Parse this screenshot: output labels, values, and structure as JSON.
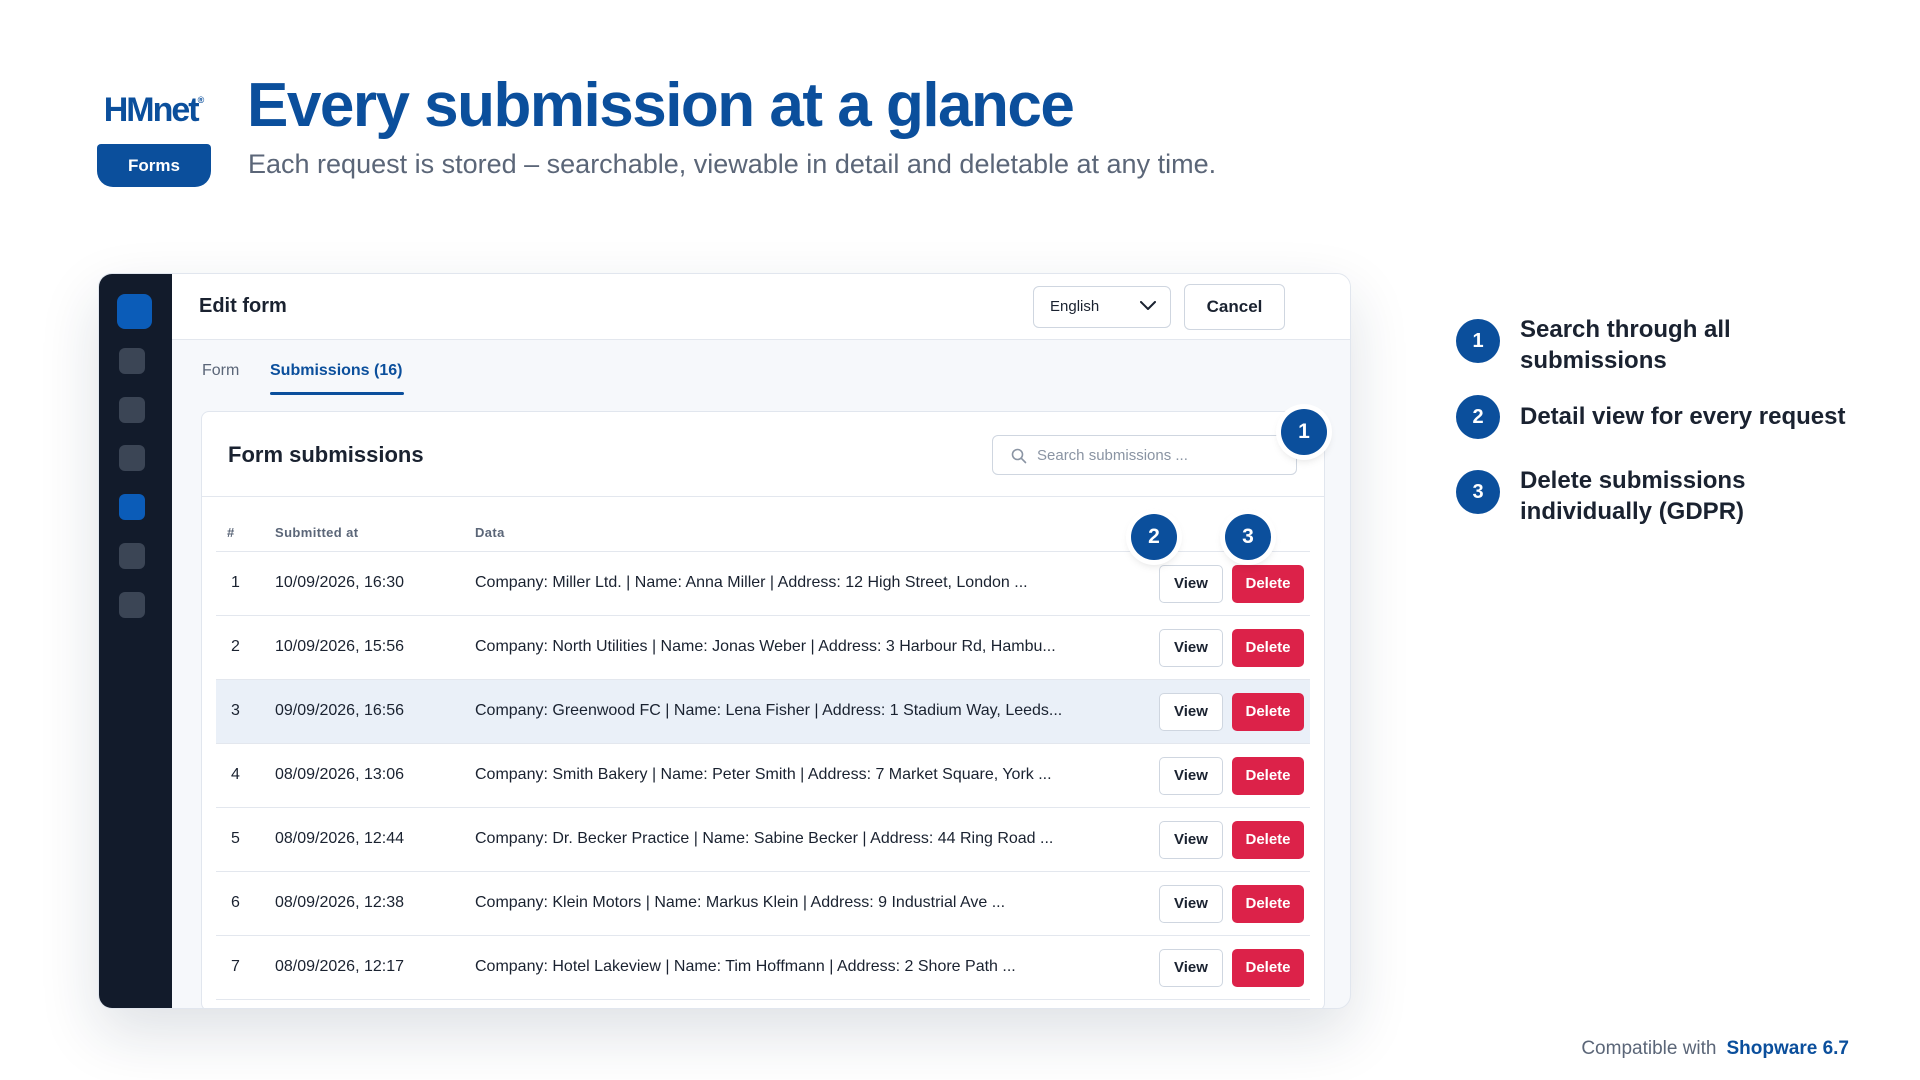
{
  "brand": {
    "logo_text": "HMnet",
    "logo_mark": "®",
    "badge": "Forms"
  },
  "hero": {
    "title": "Every submission at a glance",
    "subtitle": "Each request is stored – searchable, viewable in detail and deletable at any time."
  },
  "colors": {
    "primary": "#0b4f9c",
    "danger": "#dc2249",
    "sidebar": "#121b2b",
    "highlight_row": "#eaf0f8"
  },
  "window": {
    "title": "Edit form",
    "language": "English",
    "cancel_label": "Cancel",
    "tabs": [
      {
        "label": "Form",
        "active": false
      },
      {
        "label": "Submissions (16)",
        "active": true
      }
    ],
    "card": {
      "title": "Form submissions",
      "search_placeholder": "Search submissions ...",
      "columns": [
        "#",
        "Submitted at",
        "Data"
      ],
      "view_label": "View",
      "delete_label": "Delete",
      "rows": [
        {
          "num": "1",
          "submitted_at": "10/09/2026, 16:30",
          "data": "Company: Miller Ltd. | Name: Anna Miller | Address: 12 High Street, London ..."
        },
        {
          "num": "2",
          "submitted_at": "10/09/2026, 15:56",
          "data": "Company: North Utilities | Name: Jonas Weber | Address: 3 Harbour Rd, Hambu..."
        },
        {
          "num": "3",
          "submitted_at": "09/09/2026, 16:56",
          "data": "Company: Greenwood FC | Name: Lena Fisher | Address: 1 Stadium Way, Leeds..."
        },
        {
          "num": "4",
          "submitted_at": "08/09/2026, 13:06",
          "data": "Company: Smith Bakery | Name: Peter Smith | Address: 7 Market Square, York ..."
        },
        {
          "num": "5",
          "submitted_at": "08/09/2026, 12:44",
          "data": "Company: Dr. Becker Practice | Name: Sabine Becker | Address: 44 Ring Road ..."
        },
        {
          "num": "6",
          "submitted_at": "08/09/2026, 12:38",
          "data": "Company: Klein Motors | Name: Markus Klein | Address: 9 Industrial Ave ..."
        },
        {
          "num": "7",
          "submitted_at": "08/09/2026, 12:17",
          "data": "Company: Hotel Lakeview | Name: Tim Hoffmann | Address: 2 Shore Path ..."
        }
      ]
    },
    "callouts": [
      "1",
      "2",
      "3"
    ]
  },
  "features": [
    {
      "num": "1",
      "text": "Search through all submissions"
    },
    {
      "num": "2",
      "text": "Detail view for every request"
    },
    {
      "num": "3",
      "text": "Delete submissions individually (GDPR)"
    }
  ],
  "footer": {
    "prefix": "Compatible with",
    "product": "Shopware 6.7"
  }
}
